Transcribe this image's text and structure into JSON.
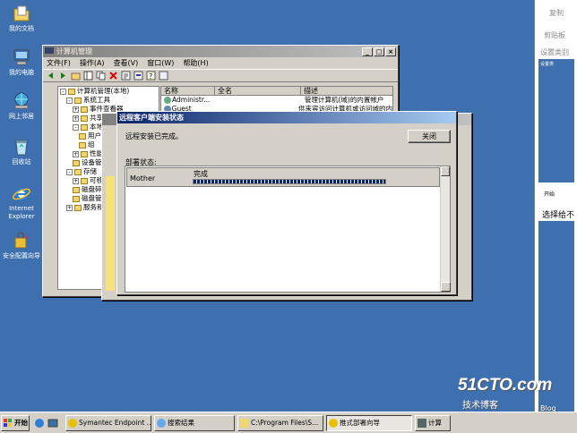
{
  "desktop": {
    "icons": [
      {
        "label": "我的文档",
        "icon": "my-documents-icon"
      },
      {
        "label": "我的电脑",
        "icon": "my-computer-icon"
      },
      {
        "label": "网上邻居",
        "icon": "network-places-icon"
      },
      {
        "label": "回收站",
        "icon": "recycle-bin-icon"
      },
      {
        "label": "Internet\nExplorer",
        "icon": "ie-icon"
      },
      {
        "label": "安全配置向导",
        "icon": "security-wizard-icon"
      }
    ]
  },
  "mgmt": {
    "title": "计算机管理",
    "menus": [
      "文件(F)",
      "操作(A)",
      "查看(V)",
      "窗口(W)",
      "帮助(H)"
    ],
    "tree": [
      {
        "label": "计算机管理(本地)",
        "indent": 0,
        "exp": "-"
      },
      {
        "label": "系统工具",
        "indent": 1,
        "exp": "-"
      },
      {
        "label": "事件查看器",
        "indent": 2,
        "exp": "+"
      },
      {
        "label": "共享文件",
        "indent": 2,
        "exp": "+"
      },
      {
        "label": "本地用户",
        "indent": 2,
        "exp": "-"
      },
      {
        "label": "用户",
        "indent": 3,
        "exp": ""
      },
      {
        "label": "组",
        "indent": 3,
        "exp": ""
      },
      {
        "label": "性能日志",
        "indent": 2,
        "exp": "+"
      },
      {
        "label": "设备管理",
        "indent": 2,
        "exp": ""
      },
      {
        "label": "存储",
        "indent": 1,
        "exp": "-"
      },
      {
        "label": "可移动存",
        "indent": 2,
        "exp": "+"
      },
      {
        "label": "磁盘碎片",
        "indent": 2,
        "exp": ""
      },
      {
        "label": "磁盘管理",
        "indent": 2,
        "exp": ""
      },
      {
        "label": "服务和应用",
        "indent": 1,
        "exp": "+"
      }
    ],
    "columns": [
      "名称",
      "全名",
      "描述"
    ],
    "rows": [
      {
        "name": "Administr...",
        "full": "",
        "desc": "管理计算机(域)的内置帐户"
      },
      {
        "name": "Guest",
        "full": "",
        "desc": "供来宾访问计算机或访问域的内"
      }
    ]
  },
  "dialog": {
    "title": "远程客户端安装状态",
    "message": "远程安装已完成。",
    "close": "关闭",
    "status_label": "部署状态:",
    "rows": [
      {
        "computer": "Mother",
        "status": "完成",
        "progress": 1.0
      }
    ]
  },
  "taskbar": {
    "start": "开始",
    "items": [
      {
        "label": "Symantec Endpoint ...",
        "pressed": false
      },
      {
        "label": "搜索结果",
        "pressed": false
      },
      {
        "label": "C:\\Program Files\\S...",
        "pressed": false
      },
      {
        "label": "推式部署向导",
        "pressed": true
      },
      {
        "label": "计算",
        "pressed": false
      }
    ]
  },
  "right": {
    "copy": "复制",
    "clipboard": "剪贴板",
    "settings": "设置类别",
    "settings2": "设置类",
    "start": "开始",
    "pick": "选择给不",
    "icons": [
      "我的文档",
      "我的电脑",
      "网上邻居",
      "回收站",
      "Internet Explorer",
      "安全配置向导"
    ]
  },
  "watermark": {
    "domain": "51CTO.com",
    "sub": "技术博客",
    "blog": "Blog"
  },
  "colors": {
    "desktop": "#3e6fae",
    "titlebar": "#0a246a",
    "progress": "#0a246a"
  }
}
